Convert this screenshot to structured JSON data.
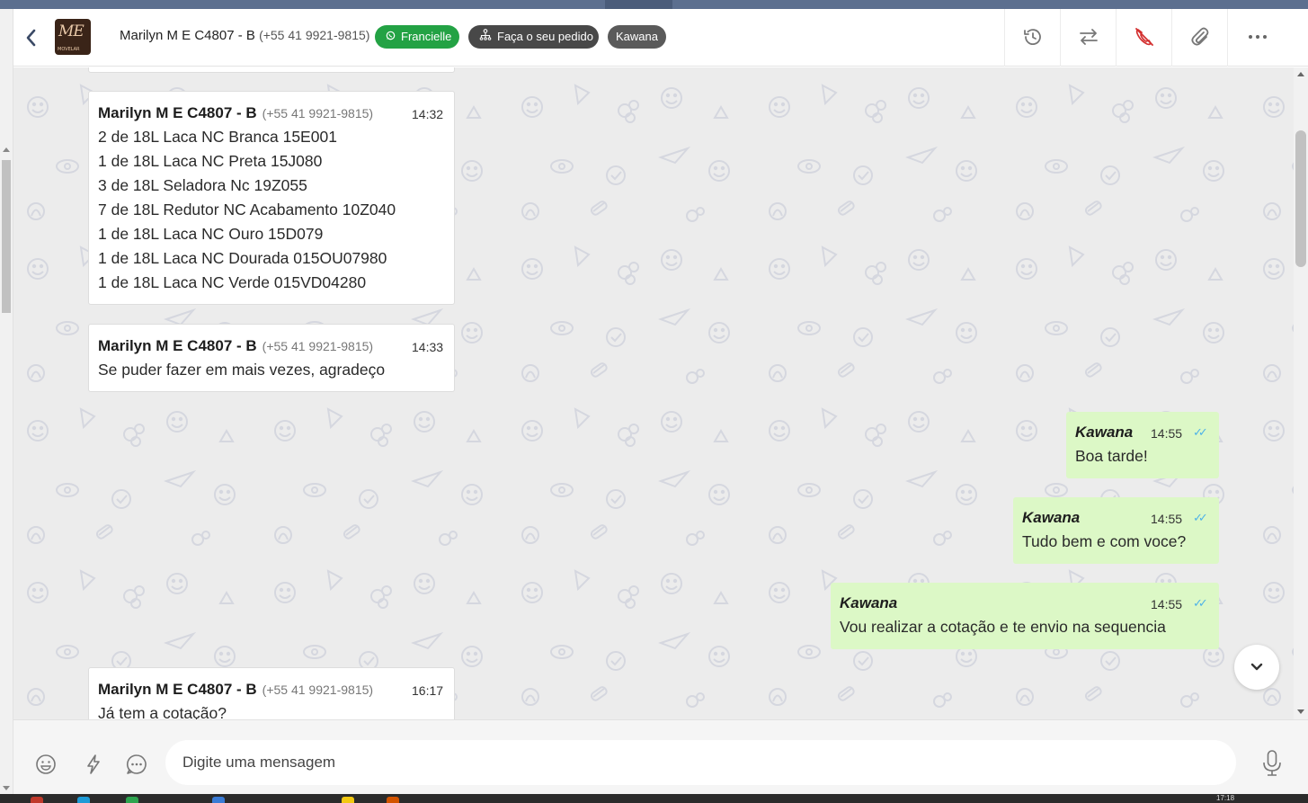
{
  "header": {
    "contact_name": "Marilyn M E C4807 - B",
    "contact_phone": "(+55 41 9921-9815)",
    "avatar_text": "ME",
    "avatar_sub": "MOVELAR",
    "badges": {
      "channel": "Francielle",
      "flow": "Faça o seu pedido",
      "agent": "Kawana"
    },
    "icons": [
      "history-icon",
      "transfer-icon",
      "end-call-icon",
      "attach-icon",
      "more-icon"
    ]
  },
  "messages": [
    {
      "direction": "in",
      "sender": "Marilyn M E C4807 - B",
      "phone": "(+55 41 9921-9815)",
      "time": "14:32",
      "lines": [
        "2 de 18L Laca NC Branca 15E001",
        "1 de 18L Laca NC Preta 15J080",
        "3 de 18L Seladora Nc 19Z055",
        "7 de 18L Redutor NC Acabamento 10Z040",
        "1 de 18L Laca NC Ouro 15D079",
        "1 de 18L Laca NC Dourada 015OU07980",
        "1 de 18L Laca NC Verde 015VD04280"
      ]
    },
    {
      "direction": "in",
      "sender": "Marilyn M E C4807 - B",
      "phone": "(+55 41 9921-9815)",
      "time": "14:33",
      "lines": [
        "Se puder fazer em mais vezes, agradeço"
      ]
    },
    {
      "direction": "out",
      "sender": "Kawana",
      "time": "14:55",
      "lines": [
        "Boa tarde!"
      ]
    },
    {
      "direction": "out",
      "sender": "Kawana",
      "time": "14:55",
      "lines": [
        "Tudo bem e com voce?"
      ]
    },
    {
      "direction": "out",
      "sender": "Kawana",
      "time": "14:55",
      "lines": [
        "Vou realizar a cotação e te envio na sequencia"
      ]
    },
    {
      "direction": "in",
      "sender": "Marilyn M E C4807 - B",
      "phone": "(+55 41 9921-9815)",
      "time": "16:17",
      "lines": [
        "Já tem a cotação?"
      ]
    }
  ],
  "composer": {
    "placeholder": "Digite uma mensagem",
    "value": ""
  },
  "taskbar": {
    "clock": "17:18"
  },
  "colors": {
    "incoming_bubble": "#ffffff",
    "outgoing_bubble": "#dcf8c6",
    "chat_background": "#ececec",
    "channel_badge": "#23a244",
    "read_ticks": "#4fb3e8",
    "end_call_icon": "#d32f2f"
  }
}
